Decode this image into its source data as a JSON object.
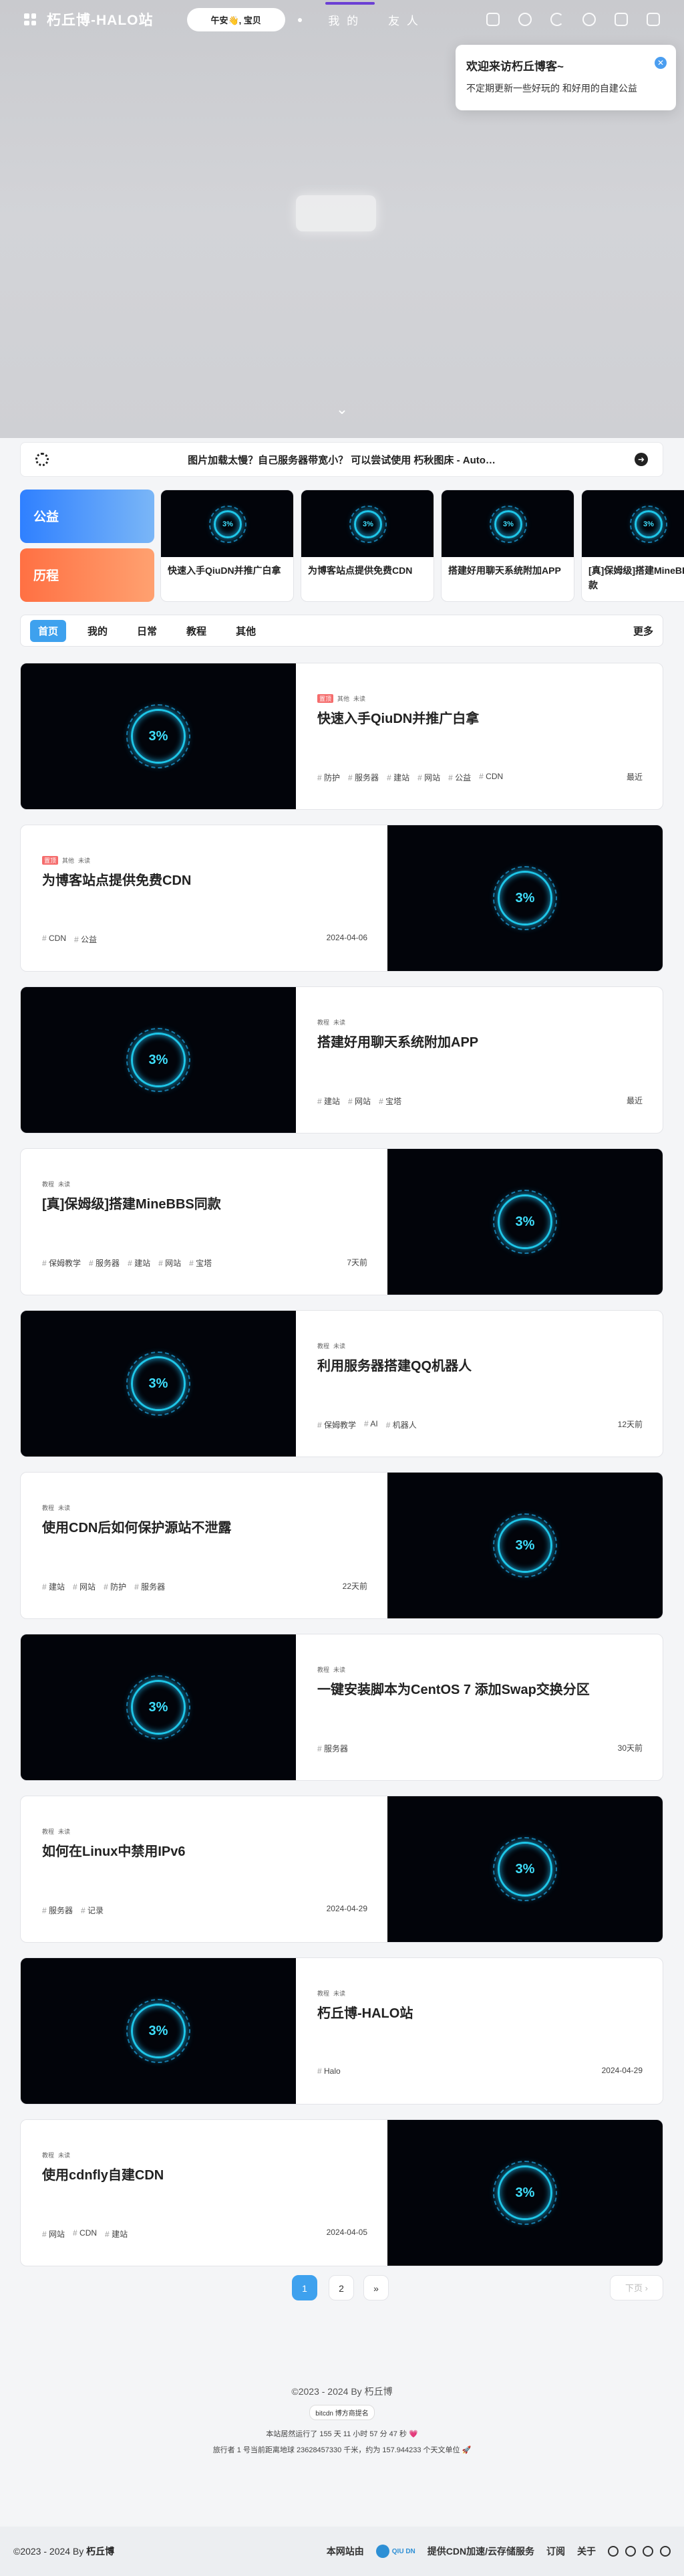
{
  "header": {
    "site_title": "朽丘博-HALO站",
    "greeting": "午安👋, 宝贝",
    "nav": [
      "我 的",
      "友 人"
    ],
    "icons": [
      "feed-icon",
      "palette-icon",
      "dark-mode-icon",
      "search-icon",
      "random-icon",
      "grid-icon"
    ]
  },
  "welcome": {
    "title": "欢迎来访朽丘博客~",
    "text": "不定期更新一些好玩的 和好用的自建公益"
  },
  "announcement": {
    "text": "图片加载太慢？自己服务器带宽小？ 可以尝试使用 朽秋图床 - Auto…"
  },
  "categories": [
    "公益",
    "历程"
  ],
  "featured": [
    "快速入手QiuDN并推广白拿",
    "为博客站点提供免费CDN",
    "搭建好用聊天系统附加APP",
    "[真]保姆级]搭建MineBBS同款"
  ],
  "tabs": [
    "首页",
    "我的",
    "日常",
    "教程",
    "其他"
  ],
  "tabs_more": "更多",
  "posts": [
    {
      "badges": [
        "置顶",
        "其他",
        "未读"
      ],
      "title": "快速入手QiuDN并推广白拿",
      "tags": [
        "防护",
        "服务器",
        "建站",
        "网站",
        "公益",
        "CDN"
      ],
      "time": "最近"
    },
    {
      "badges": [
        "置顶",
        "其他",
        "未读"
      ],
      "title": "为博客站点提供免费CDN",
      "tags": [
        "CDN",
        "公益"
      ],
      "time": "2024-04-06"
    },
    {
      "badges": [
        "教程",
        "未读"
      ],
      "title": "搭建好用聊天系统附加APP",
      "tags": [
        "建站",
        "网站",
        "宝塔"
      ],
      "time": "最近"
    },
    {
      "badges": [
        "教程",
        "未读"
      ],
      "title": "[真]保姆级]搭建MineBBS同款",
      "tags": [
        "保姆教学",
        "服务器",
        "建站",
        "网站",
        "宝塔"
      ],
      "time": "7天前"
    },
    {
      "badges": [
        "教程",
        "未读"
      ],
      "title": "利用服务器搭建QQ机器人",
      "tags": [
        "保姆教学",
        "AI",
        "机器人"
      ],
      "time": "12天前"
    },
    {
      "badges": [
        "教程",
        "未读"
      ],
      "title": "使用CDN后如何保护源站不泄露",
      "tags": [
        "建站",
        "网站",
        "防护",
        "服务器"
      ],
      "time": "22天前"
    },
    {
      "badges": [
        "教程",
        "未读"
      ],
      "title": "一键安装脚本为CentOS 7 添加Swap交换分区",
      "tags": [
        "服务器"
      ],
      "time": "30天前"
    },
    {
      "badges": [
        "教程",
        "未读"
      ],
      "title": "如何在Linux中禁用IPv6",
      "tags": [
        "服务器",
        "记录"
      ],
      "time": "2024-04-29"
    },
    {
      "badges": [
        "教程",
        "未读"
      ],
      "title": "朽丘博-HALO站",
      "tags": [
        "Halo"
      ],
      "time": "2024-04-29"
    },
    {
      "badges": [
        "教程",
        "未读"
      ],
      "title": "使用cdnfly自建CDN",
      "tags": [
        "网站",
        "CDN",
        "建站"
      ],
      "time": "2024-04-05"
    }
  ],
  "pagination": {
    "pages": [
      "1",
      "2"
    ],
    "next_icon": "»",
    "next_label": "下页"
  },
  "footer": {
    "copy": "©2023 - 2024 By 朽丘博",
    "badge": "bitcdn 博方商提名",
    "runtime": "本站居然运行了 155 天 11 小时 57 分 47 秒 💗",
    "trip": "旅行者 1 号当前距离地球 23628457330 千米，约为 157.944233 个天文单位 🚀"
  },
  "bottom_bar": {
    "copy": "©2023 - 2024 By",
    "author": "朽丘博",
    "links": [
      "本网站由",
      "提供CDN加速/云存储服务",
      "订阅",
      "关于"
    ],
    "cdn_name": "QIU DN"
  },
  "logo_text": "3%"
}
